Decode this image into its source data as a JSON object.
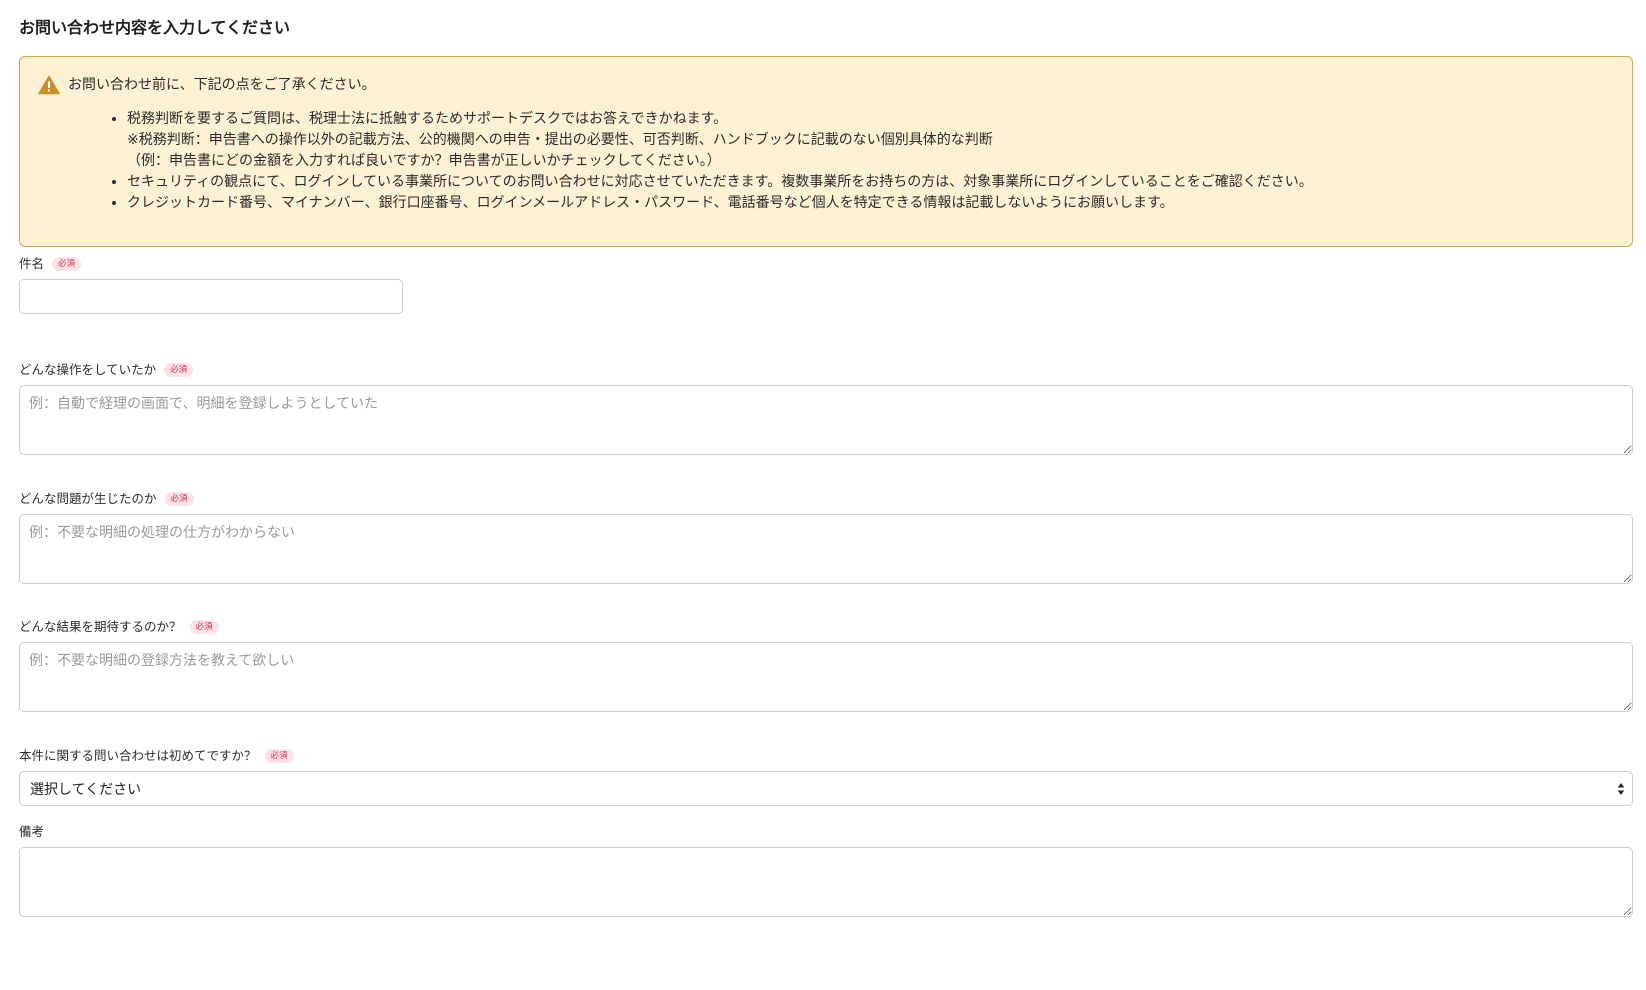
{
  "page": {
    "title": "お問い合わせ内容を入力してください"
  },
  "notice": {
    "heading": "お問い合わせ前に、下記の点をご了承ください。",
    "items": [
      {
        "lines": [
          "税務判断を要するご質問は、税理士法に抵触するためサポートデスクではお答えできかねます。",
          "※税務判断：申告書への操作以外の記載方法、公的機関への申告・提出の必要性、可否判断、ハンドブックに記載のない個別具体的な判断",
          "（例：申告書にどの金額を入力すれば良いですか？申告書が正しいかチェックしてください。）"
        ]
      },
      {
        "lines": [
          "セキュリティの観点にて、ログインしている事業所についてのお問い合わせに対応させていただきます。複数事業所をお持ちの方は、対象事業所にログインしていることをご確認ください。"
        ]
      },
      {
        "lines": [
          "クレジットカード番号、マイナンバー、銀行口座番号、ログインメールアドレス・パスワード、電話番号など個人を特定できる情報は記載しないようにお願いします。"
        ]
      }
    ]
  },
  "required_badge": "必須",
  "form": {
    "subject": {
      "label": "件名",
      "value": ""
    },
    "operation": {
      "label": "どんな操作をしていたか",
      "placeholder": "例：自動で経理の画面で、明細を登録しようとしていた"
    },
    "problem": {
      "label": "どんな問題が生じたのか",
      "placeholder": "例：不要な明細の処理の仕方がわからない"
    },
    "expected": {
      "label": "どんな結果を期待するのか？",
      "placeholder": "例：不要な明細の登録方法を教えて欲しい"
    },
    "first_time": {
      "label": "本件に関する問い合わせは初めてですか？",
      "selected": "選択してください"
    },
    "remarks": {
      "label": "備考",
      "placeholder": ""
    }
  },
  "colors": {
    "notice_bg": "#fff1d4",
    "notice_border": "#d4a44c",
    "warning_icon": "#c8902a",
    "required_text": "#d0304a",
    "required_bg": "#fde3e8",
    "input_border": "#c9ccd1"
  },
  "icons": {
    "notice": "warning-triangle-icon",
    "select": "select-arrows-icon"
  }
}
